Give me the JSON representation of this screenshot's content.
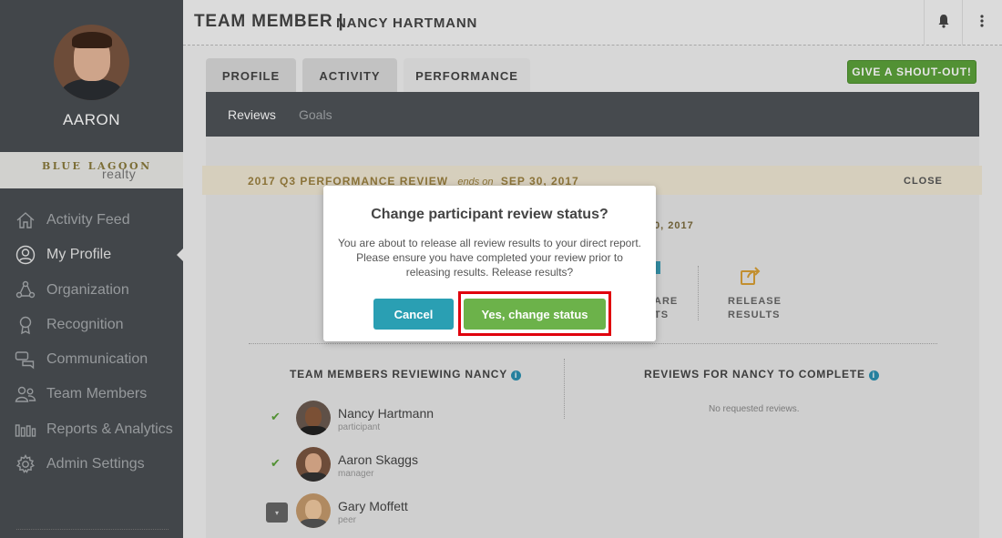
{
  "sidebar": {
    "user_name": "AARON",
    "brand_line1": "BLUE LAGOON",
    "brand_line2": "realty",
    "items": [
      {
        "label": "Activity Feed",
        "icon": "home-icon"
      },
      {
        "label": "My Profile",
        "icon": "user-circle-icon"
      },
      {
        "label": "Organization",
        "icon": "organization-icon"
      },
      {
        "label": "Recognition",
        "icon": "award-ribbon-icon"
      },
      {
        "label": "Communication",
        "icon": "chat-bubbles-icon"
      },
      {
        "label": "Team Members",
        "icon": "team-icon"
      },
      {
        "label": "Reports & Analytics",
        "icon": "bar-chart-icon"
      },
      {
        "label": "Admin Settings",
        "icon": "gear-icon"
      }
    ]
  },
  "header": {
    "title": "TEAM MEMBER |",
    "subtitle": "NANCY HARTMANN"
  },
  "tabs": [
    {
      "label": "PROFILE"
    },
    {
      "label": "ACTIVITY"
    },
    {
      "label": "PERFORMANCE"
    }
  ],
  "shout_out_label": "GIVE A SHOUT-OUT!",
  "subnav": {
    "reviews": "Reviews",
    "goals": "Goals"
  },
  "review": {
    "title": "2017 Q3 PERFORMANCE REVIEW",
    "ends_label": "ends on",
    "ends_date": "SEP 30, 2017",
    "close": "CLOSE",
    "date_fragment": "0, 2017",
    "share_line1": "ARE",
    "share_line2": "TS",
    "release_line1": "RELEASE",
    "release_line2": "RESULTS"
  },
  "reviewing": {
    "heading": "TEAM MEMBERS REVIEWING NANCY",
    "members": [
      {
        "name": "Nancy Hartmann",
        "role": "participant",
        "check": "✔"
      },
      {
        "name": "Aaron Skaggs",
        "role": "manager",
        "check": "✔"
      },
      {
        "name": "Gary Moffett",
        "role": "peer",
        "check": "▾"
      }
    ]
  },
  "to_complete": {
    "heading": "REVIEWS FOR NANCY TO COMPLETE",
    "empty": "No requested reviews."
  },
  "modal": {
    "title": "Change participant review status?",
    "body": "You are about to release all review results to your direct report. Please ensure you have completed your review prior to releasing results. Release results?",
    "cancel": "Cancel",
    "confirm": "Yes, change status"
  },
  "colors": {
    "sidebar": "#4a4f53",
    "accent_green": "#5ca23a",
    "accent_teal": "#2a9fb3",
    "highlight_red": "#e0000d"
  }
}
